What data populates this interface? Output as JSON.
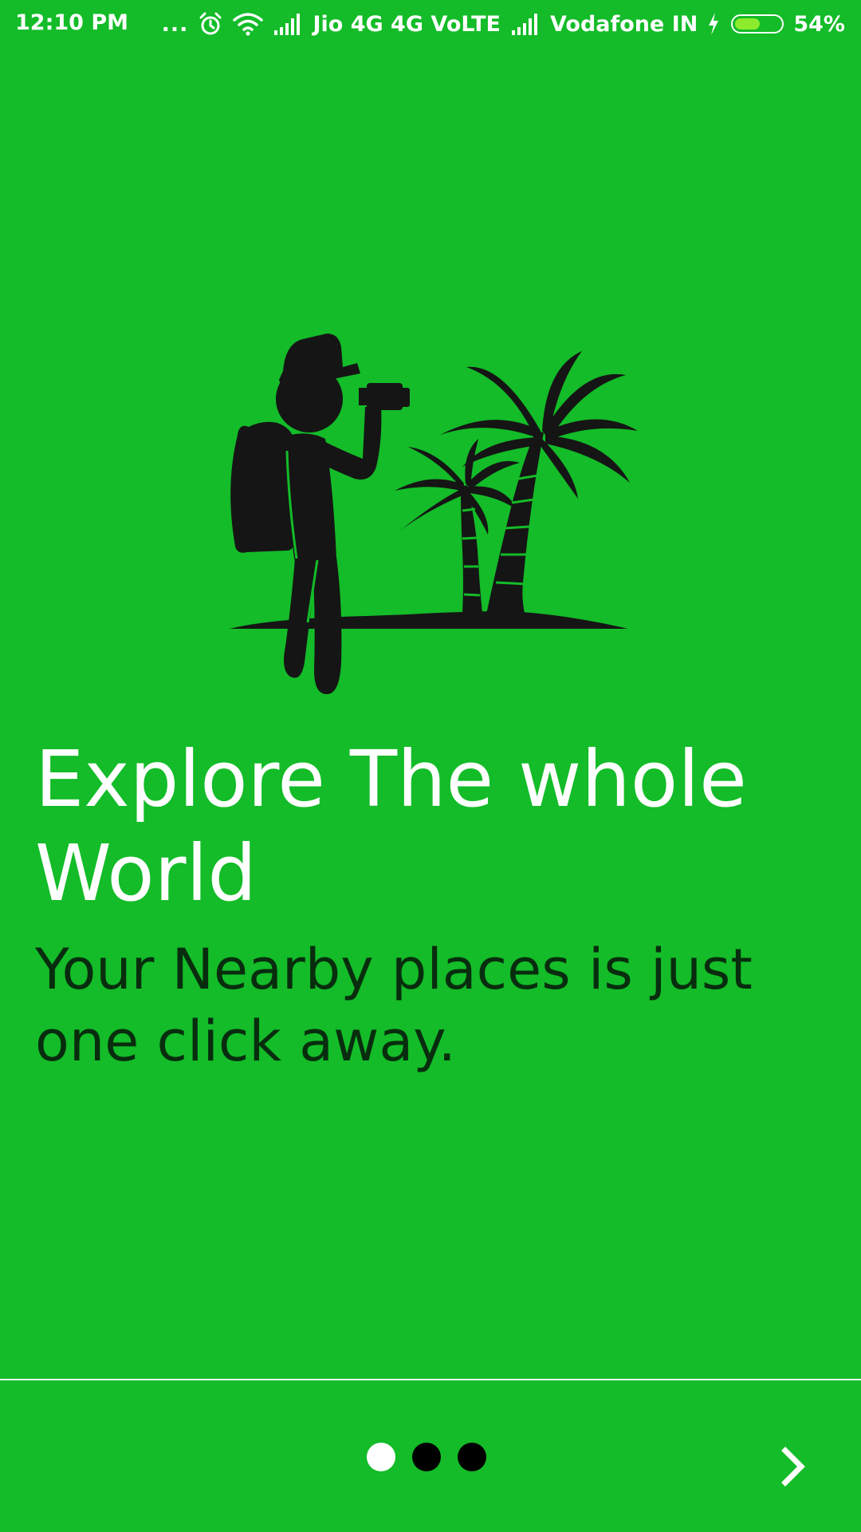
{
  "status_bar": {
    "time": "12:10 PM",
    "overflow_dots": "...",
    "carrier1": "Jio 4G 4G VoLTE",
    "carrier2": "Vodafone IN",
    "battery_percent": "54%",
    "battery_level": 0.54,
    "icons": [
      "alarm-icon",
      "wifi-icon",
      "signal-icon",
      "signal-icon",
      "charging-icon",
      "battery-icon"
    ]
  },
  "onboarding": {
    "illustration": "traveler-with-camera-and-palm-trees",
    "title": "Explore The whole World",
    "subtitle": "Your Nearby places is just one click away."
  },
  "pager": {
    "page_count": 3,
    "current_page": 1,
    "next_icon": "chevron-right-icon"
  },
  "colors": {
    "background": "#13BC28",
    "title_text": "#FFFFFF",
    "subtitle_text": "#082D0E",
    "dot_active": "#FFFFFF",
    "dot_inactive": "#000000",
    "illustration": "#151515"
  }
}
